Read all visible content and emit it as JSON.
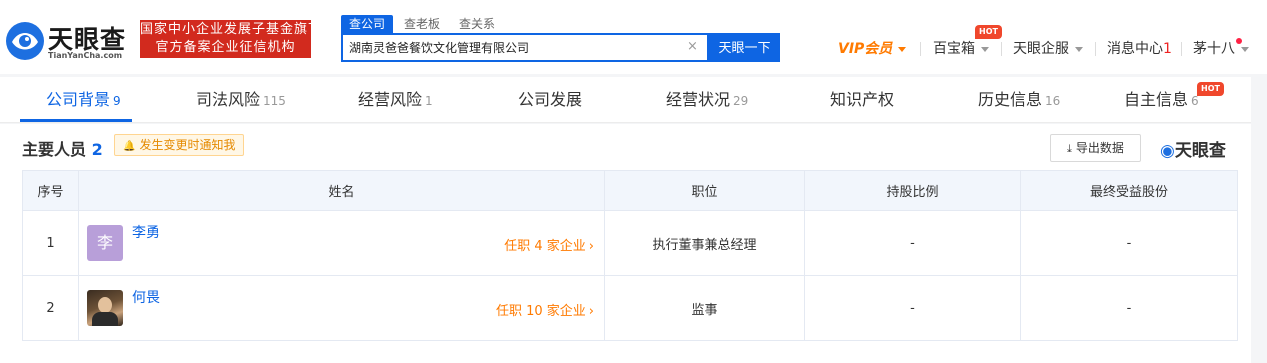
{
  "header": {
    "logo_text": "天眼查",
    "logo_sub": "TianYanCha.com",
    "gov_badge": [
      "国家中小企业发展子基金旗下",
      "官方备案企业征信机构"
    ],
    "search_tabs": [
      "查公司",
      "查老板",
      "查关系"
    ],
    "search_value": "湖南灵爸爸餐饮文化管理有限公司",
    "search_button": "天眼一下",
    "nav": {
      "vip": "VIP会员",
      "baobox": "百宝箱",
      "hot": "HOT",
      "enterprise": "天眼企服",
      "messages_label": "消息中心",
      "messages_count": "1",
      "user": "茅十八"
    }
  },
  "tabs": [
    {
      "label": "公司背景",
      "count": "9"
    },
    {
      "label": "司法风险",
      "count": "115"
    },
    {
      "label": "经营风险",
      "count": "1"
    },
    {
      "label": "公司发展",
      "count": ""
    },
    {
      "label": "经营状况",
      "count": "29"
    },
    {
      "label": "知识产权",
      "count": ""
    },
    {
      "label": "历史信息",
      "count": "16"
    },
    {
      "label": "自主信息",
      "count": "6"
    }
  ],
  "tabs_hot": "HOT",
  "section": {
    "title": "主要人员",
    "count": "2",
    "notify": "发生变更时通知我",
    "export": "导出数据",
    "brand": "天眼查"
  },
  "table": {
    "headers": [
      "序号",
      "姓名",
      "职位",
      "持股比例",
      "最终受益股份"
    ],
    "rows": [
      {
        "index": "1",
        "avatar_char": "李",
        "name": "李勇",
        "held": "任职 4 家企业",
        "position": "执行董事兼总经理",
        "share": "-",
        "benefit": "-"
      },
      {
        "index": "2",
        "avatar_char": "",
        "name": "何畏",
        "held": "任职 10 家企业",
        "position": "监事",
        "share": "-",
        "benefit": "-"
      }
    ]
  },
  "colors": {
    "brand_blue": "#0e65e3",
    "vip_orange": "#ff7a00",
    "gov_red": "#d22a1e"
  }
}
